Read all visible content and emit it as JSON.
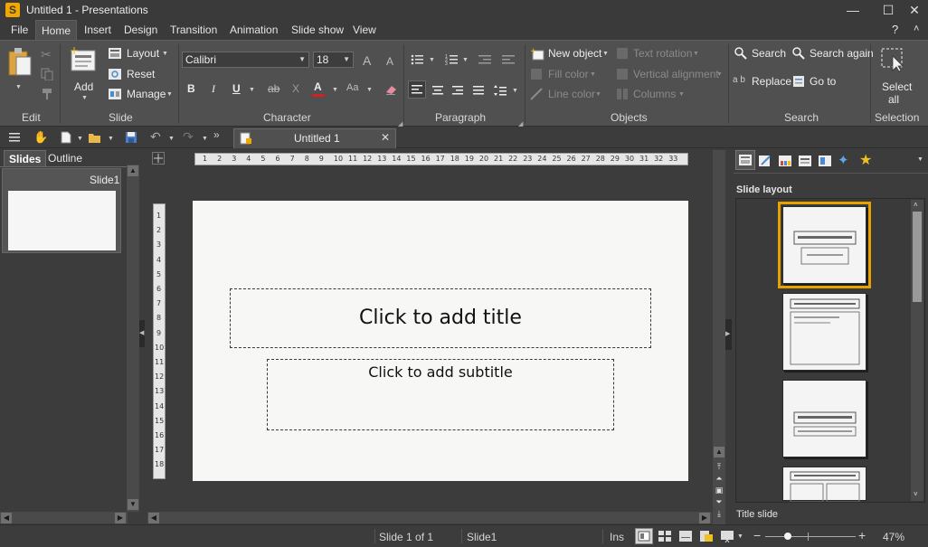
{
  "window": {
    "title": "Untitled 1 - Presentations",
    "app_icon_letter": "S",
    "minimize_glyph": "—",
    "maximize_glyph": "☐",
    "close_glyph": "✕",
    "help_glyph": "?",
    "collapse_glyph": "˄"
  },
  "menu": [
    "File",
    "Home",
    "Insert",
    "Design",
    "Transition",
    "Animation",
    "Slide show",
    "View"
  ],
  "ribbon": {
    "edit": {
      "label": "Edit"
    },
    "slide": {
      "add": "Add",
      "layout": "Layout",
      "reset": "Reset",
      "manage": "Manage",
      "label": "Slide"
    },
    "character": {
      "font": "Calibri",
      "size": "18",
      "grow": "A",
      "shrink": "A",
      "bold": "B",
      "italic": "I",
      "underline": "U",
      "strike": "ab",
      "clear": "X",
      "color": "A",
      "case": "Aa",
      "label": "Character"
    },
    "paragraph": {
      "label": "Paragraph"
    },
    "objects": {
      "new_object": "New object",
      "fill_color": "Fill color",
      "line_color": "Line color",
      "text_rotation": "Text rotation",
      "vertical_alignment": "Vertical alignment",
      "columns": "Columns",
      "label": "Objects"
    },
    "search": {
      "search": "Search",
      "search_again": "Search again",
      "replace": "Replace",
      "replace_prefix": "a b",
      "goto": "Go to",
      "label": "Search"
    },
    "selection": {
      "select": "Select",
      "all": "all",
      "label": "Selection"
    }
  },
  "toolbar": {
    "doc_tab": "Untitled 1",
    "overflow": "»",
    "close_tab": "✕"
  },
  "left_panel": {
    "tabs": [
      "Slides",
      "Outline"
    ],
    "slide_thumb_label": "Slide1"
  },
  "ruler": {
    "h": [
      "1",
      "2",
      "3",
      "4",
      "5",
      "6",
      "7",
      "8",
      "9",
      "10",
      "11",
      "12",
      "13",
      "14",
      "15",
      "16",
      "17",
      "18",
      "19",
      "20",
      "21",
      "22",
      "23",
      "24",
      "25",
      "26",
      "27",
      "28",
      "29",
      "30",
      "31",
      "32",
      "33"
    ],
    "v": [
      "1",
      "2",
      "3",
      "4",
      "5",
      "6",
      "7",
      "8",
      "9",
      "10",
      "11",
      "12",
      "13",
      "14",
      "15",
      "16",
      "17",
      "18"
    ]
  },
  "slide": {
    "title": "Click to add title",
    "subtitle": "Click to add subtitle"
  },
  "right_panel": {
    "heading": "Slide layout",
    "footer": "Title slide"
  },
  "status": {
    "slide_pos": "Slide 1 of 1",
    "slide_name": "Slide1",
    "ins": "Ins",
    "zoom": "47%",
    "zoom_minus": "−",
    "zoom_plus": "+",
    "zoom_level": 0.47
  },
  "colors": {
    "accent": "#e8a200",
    "font_color_bar": "#d42020",
    "icon_blue": "#5fa8e8"
  }
}
